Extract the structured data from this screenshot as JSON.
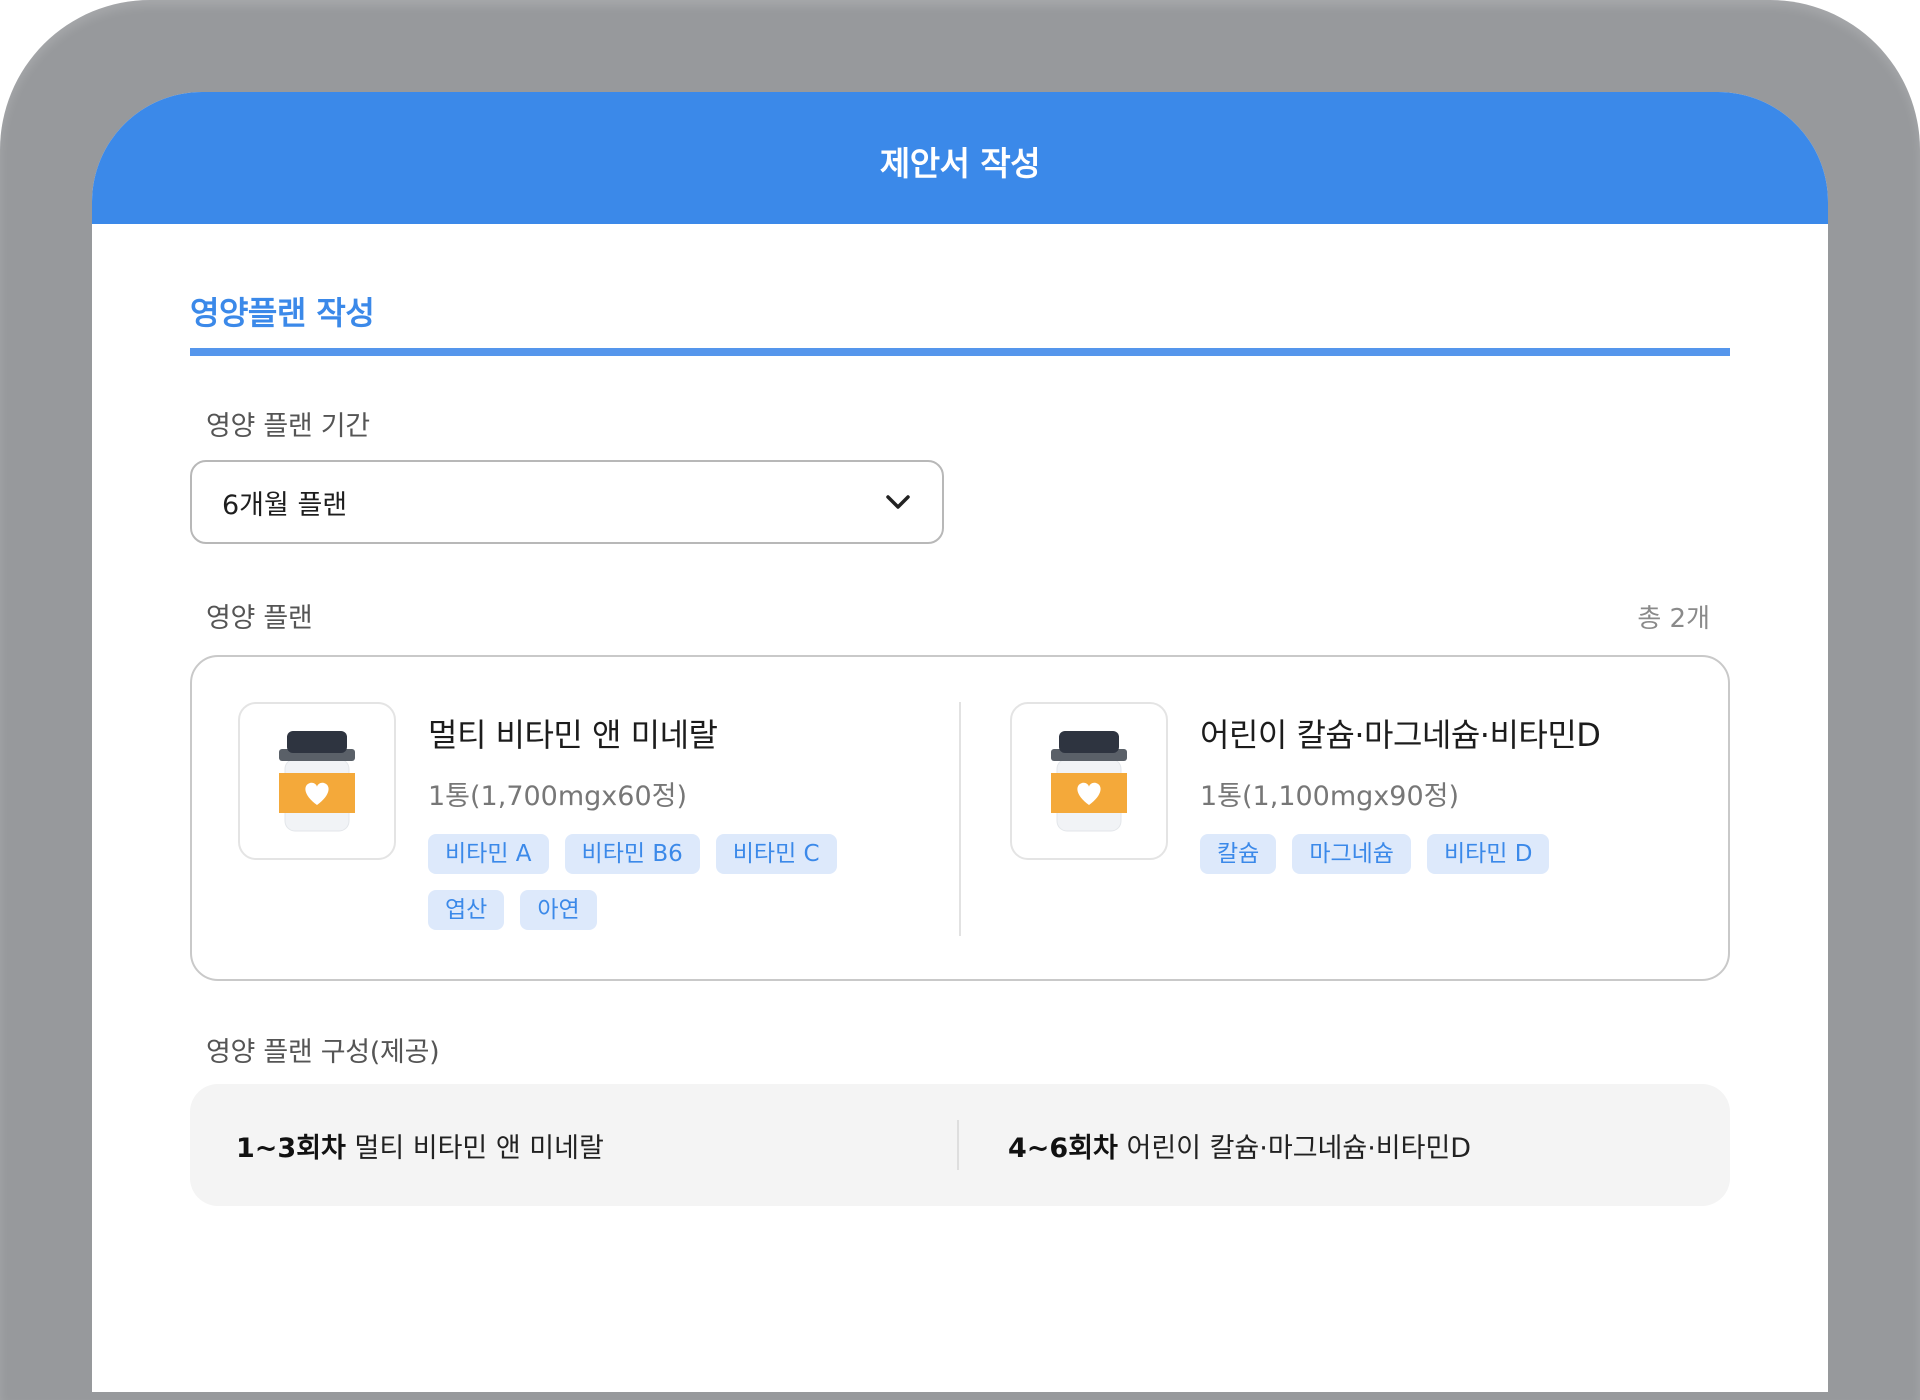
{
  "header": {
    "title": "제안서 작성"
  },
  "section": {
    "title": "영양플랜 작성"
  },
  "period": {
    "label": "영양 플랜 기간",
    "selected": "6개월 플랜"
  },
  "plan": {
    "label": "영양 플랜",
    "count": "총 2개",
    "products": [
      {
        "name": "멀티 비타민 앤 미네랄",
        "desc": "1통(1,700mgx60정)",
        "tags": [
          "비타민 A",
          "비타민 B6",
          "비타민 C",
          "엽산",
          "아연"
        ]
      },
      {
        "name": "어린이 칼슘·마그네슘·비타민D",
        "desc": "1통(1,100mgx90정)",
        "tags": [
          "칼슘",
          "마그네슘",
          "비타민 D"
        ]
      }
    ]
  },
  "composition": {
    "label": "영양 플랜 구성(제공)",
    "items": [
      {
        "round": "1~3회차",
        "product": "멀티 비타민 앤 미네랄"
      },
      {
        "round": "4~6회차",
        "product": "어린이 칼슘·마그네슘·비타민D"
      }
    ]
  },
  "colors": {
    "primary": "#3b89e9",
    "tag_bg": "#dde9fb",
    "device_frame": "#97999c"
  }
}
